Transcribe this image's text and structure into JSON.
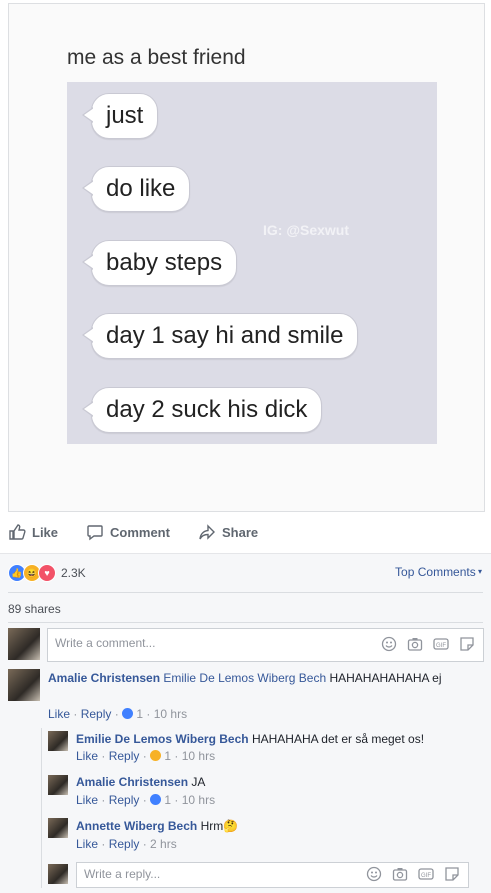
{
  "meme": {
    "caption": "me as a best friend",
    "watermark": "IG: @Sexwut",
    "bubbles": [
      "just",
      "do like",
      "baby steps",
      "day 1 say hi and smile",
      "day 2 suck his dick"
    ]
  },
  "actions": {
    "like": "Like",
    "comment": "Comment",
    "share": "Share"
  },
  "reactions": {
    "count": "2.3K",
    "colors": {
      "like": "#4080ff",
      "haha": "#f7b125",
      "love": "#f25268"
    }
  },
  "top_comments": "Top Comments",
  "shares": "89 shares",
  "composer": {
    "placeholder": "Write a comment..."
  },
  "reply_composer": {
    "placeholder": "Write a reply..."
  },
  "comments": [
    {
      "name": "Amalie Christensen",
      "tag": "Emilie De Lemos Wiberg Bech",
      "text": "HAHAHAHAHAHA ej",
      "like": "Like",
      "reply": "Reply",
      "count": "1",
      "time": "10 hrs"
    },
    {
      "name": "Emilie De Lemos Wiberg Bech",
      "text": "HAHAHAHA det er så meget os!",
      "like": "Like",
      "reply": "Reply",
      "count": "1",
      "time": "10 hrs"
    },
    {
      "name": "Amalie Christensen",
      "text": "JA",
      "like": "Like",
      "reply": "Reply",
      "count": "1",
      "time": "10 hrs"
    },
    {
      "name": "Annette Wiberg Bech",
      "text": "Hrm",
      "like": "Like",
      "reply": "Reply",
      "time": "2 hrs"
    }
  ]
}
